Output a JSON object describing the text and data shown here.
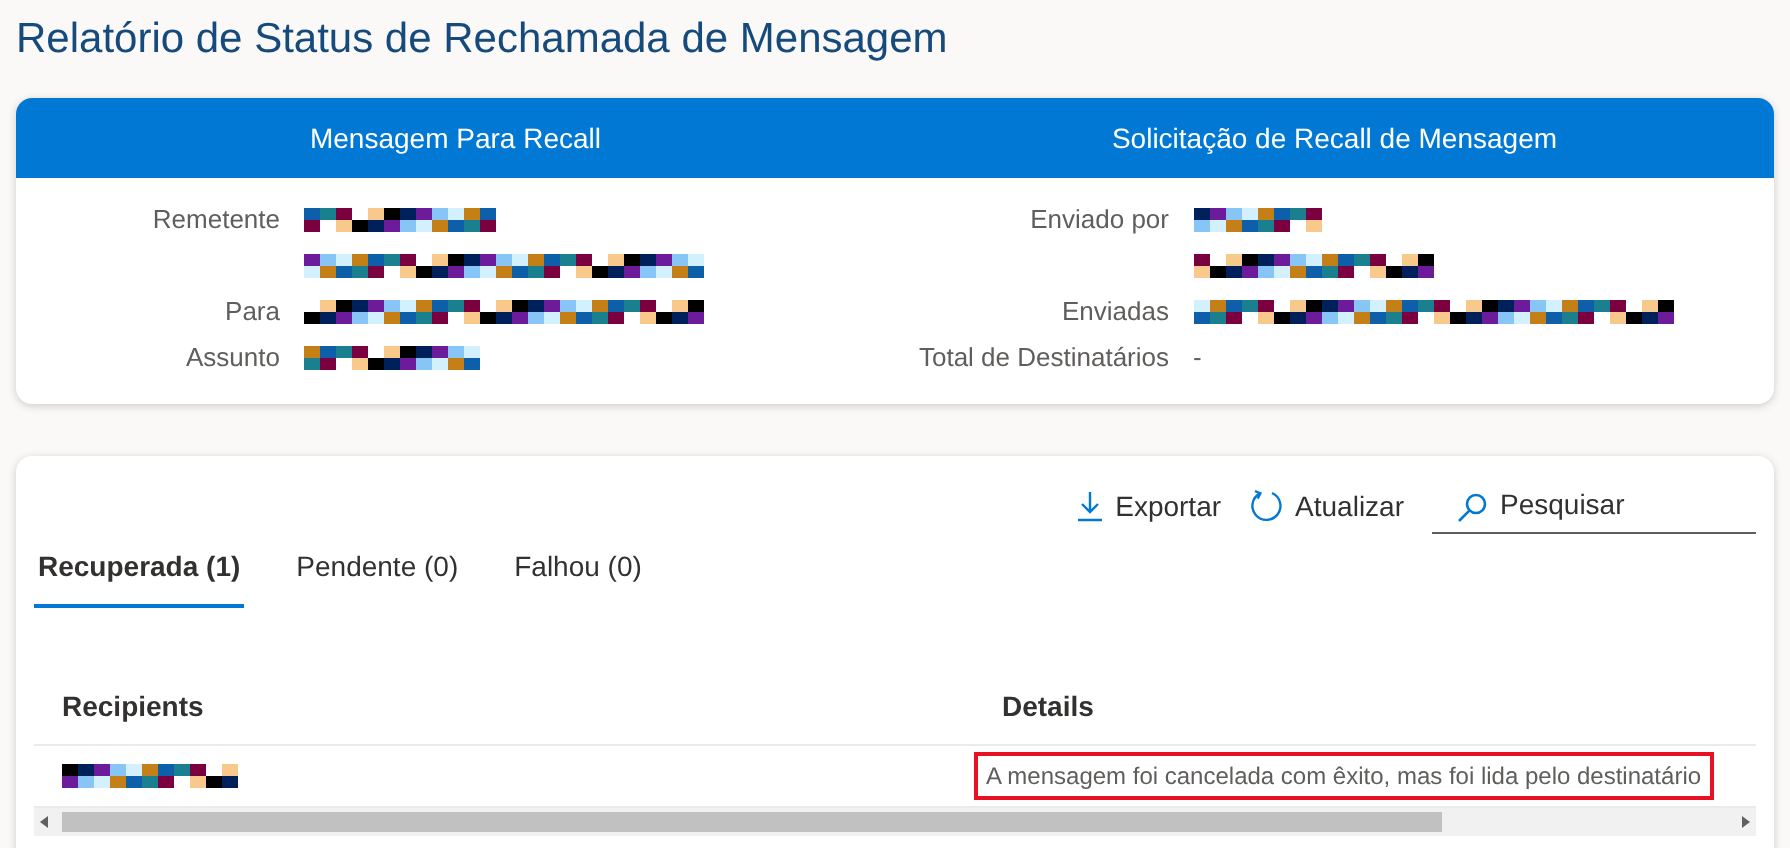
{
  "page_title": "Relatório de Status de Rechamada de Mensagem",
  "summary": {
    "sections": [
      {
        "title": "Mensagem Para Recall",
        "fields": [
          {
            "label": "Remetente",
            "values": [
              {
                "kind": "redacted"
              },
              {
                "kind": "redacted"
              }
            ]
          },
          {
            "label": "Para",
            "values": [
              {
                "kind": "redacted"
              }
            ]
          },
          {
            "label": "Assunto",
            "values": [
              {
                "kind": "redacted"
              }
            ]
          }
        ]
      },
      {
        "title": "Solicitação de Recall de Mensagem",
        "fields": [
          {
            "label": "Enviado por",
            "values": [
              {
                "kind": "redacted"
              },
              {
                "kind": "redacted"
              }
            ]
          },
          {
            "label": "Enviadas",
            "values": [
              {
                "kind": "redacted"
              }
            ]
          },
          {
            "label": "Total de Destinatários",
            "values": [
              {
                "kind": "text",
                "text": "-"
              }
            ]
          }
        ]
      }
    ]
  },
  "toolbar": [
    {
      "kind": "export",
      "label": "Exportar"
    },
    {
      "kind": "refresh",
      "label": "Atualizar"
    }
  ],
  "search": {
    "placeholder": "Pesquisar"
  },
  "tabs": [
    {
      "label": "Recuperada (1)",
      "selected": true
    },
    {
      "label": "Pendente (0)",
      "selected": false
    },
    {
      "label": "Falhou (0)",
      "selected": false
    }
  ],
  "table": {
    "columns": [
      "Recipients",
      "Details"
    ],
    "rows": [
      {
        "recipient": {
          "kind": "redacted"
        },
        "details": {
          "text": "A mensagem foi cancelada com êxito, mas foi lida pelo destinatário",
          "highlighted": true
        }
      }
    ]
  }
}
